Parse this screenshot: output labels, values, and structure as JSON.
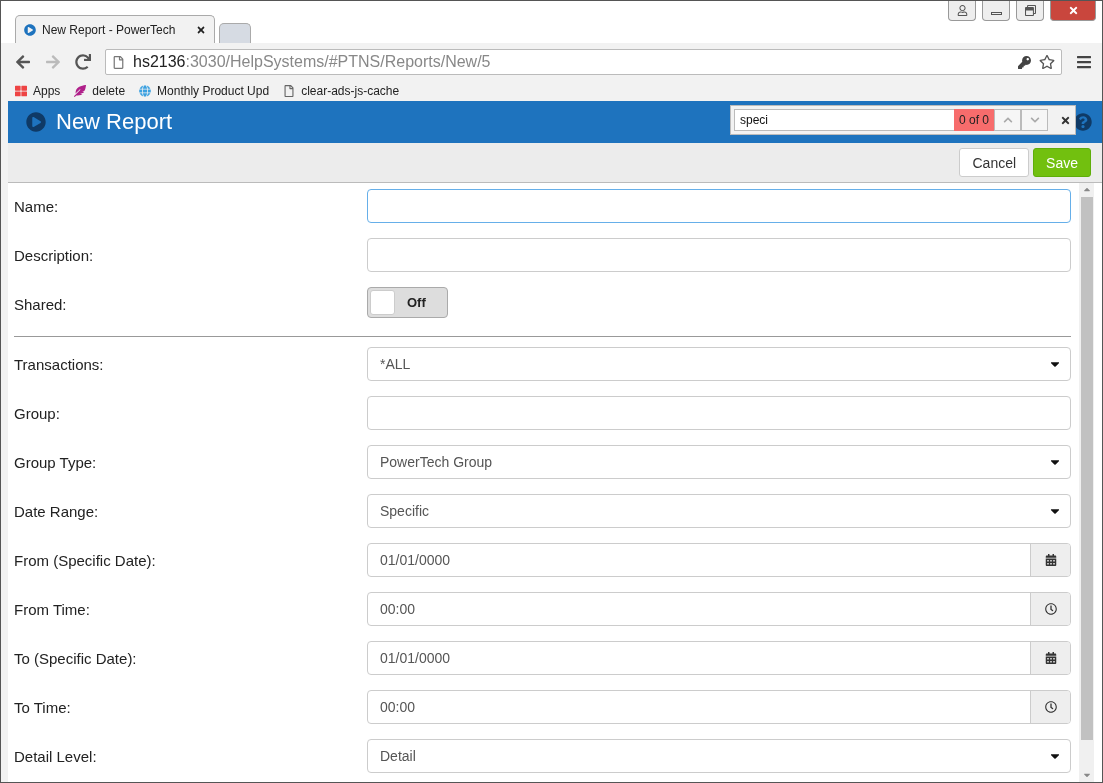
{
  "browser": {
    "tabs": [
      {
        "title": "New Report - PowerTech",
        "selected": true,
        "kind": "page"
      },
      {
        "selected": false,
        "kind": "new"
      }
    ],
    "url": {
      "host": "hs2136",
      "path": ":3030/HelpSystems/#PTNS/Reports/New/5"
    },
    "bookmarks": [
      {
        "label": "Apps",
        "kind": "apps"
      },
      {
        "label": "delete",
        "kind": "feather"
      },
      {
        "label": "Monthly Product Upd",
        "kind": "globe"
      },
      {
        "label": "clear-ads-js-cache",
        "kind": "page"
      }
    ]
  },
  "find_bar": {
    "query": "speci",
    "count": "0 of 0"
  },
  "header": {
    "title": "New Report"
  },
  "toolbar": {
    "buttons": [
      {
        "label": "Cancel",
        "kind": "default"
      },
      {
        "label": "Save",
        "kind": "primary"
      }
    ]
  },
  "form": [
    {
      "kind": "text",
      "label": "Name:",
      "focused": true
    },
    {
      "kind": "text",
      "label": "Description:",
      "focused": false
    },
    {
      "kind": "toggle",
      "label": "Shared:",
      "on": false,
      "text": "Off"
    },
    {
      "kind": "divider"
    },
    {
      "kind": "select",
      "label": "Transactions:",
      "value": "*ALL"
    },
    {
      "kind": "text",
      "label": "Group:",
      "focused": false
    },
    {
      "kind": "select",
      "label": "Group Type:",
      "value": "PowerTech Group"
    },
    {
      "kind": "select",
      "label": "Date Range:",
      "value": "Specific"
    },
    {
      "kind": "date",
      "label": "From (Specific Date):",
      "value": "01/01/0000"
    },
    {
      "kind": "time",
      "label": "From Time:",
      "value": "00:00"
    },
    {
      "kind": "date",
      "label": "To (Specific Date):",
      "value": "01/01/0000"
    },
    {
      "kind": "time",
      "label": "To Time:",
      "value": "00:00"
    },
    {
      "kind": "select",
      "label": "Detail Level:",
      "value": "Detail"
    }
  ]
}
